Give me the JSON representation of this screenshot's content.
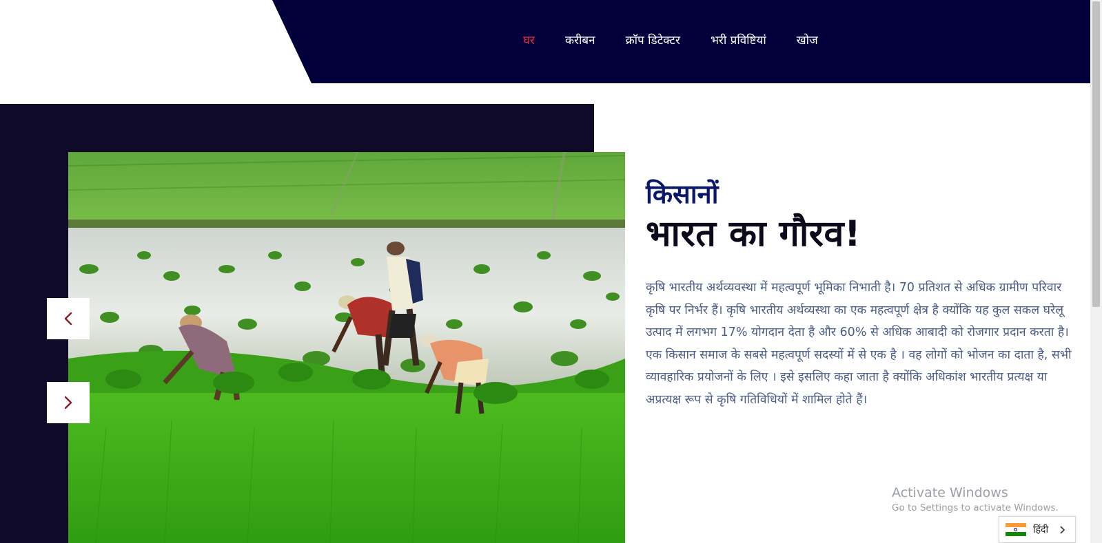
{
  "nav": {
    "items": [
      {
        "label": "घर",
        "active": true
      },
      {
        "label": "करीबन",
        "active": false
      },
      {
        "label": "क्रॉप डिटेक्टर",
        "active": false
      },
      {
        "label": "भरी प्रविष्टियां",
        "active": false
      },
      {
        "label": "खोज",
        "active": false
      }
    ],
    "background_color": "#02003a",
    "active_color": "#e6293b"
  },
  "hero": {
    "subtitle": "किसानों",
    "title": "भारत का गौरव!",
    "body": "कृषि भारतीय अर्थव्यवस्था में महत्वपूर्ण भूमिका निभाती है। 70 प्रतिशत से अधिक ग्रामीण परिवार कृषि पर निर्भर हैं। कृषि भारतीय अर्थव्यस्था का एक महत्वपूर्ण क्षेत्र है क्योंकि यह कुल सकल घरेलू उत्पाद में लगभग 17% योगदान देता है और 60% से अधिक आबादी को रोजगार प्रदान करता है। एक किसान समाज के सबसे महत्वपूर्ण सदस्यों में से एक है । वह लोगों को भोजन का दाता है, सभी व्यावहारिक प्रयोजनों के लिए । इसे इसलिए कहा जाता है क्योंकि अधिकांश भारतीय प्रत्यक्ष या अप्रत्यक्ष रूप से कृषि गतिविधियों में शामिल होते हैं।",
    "prev_icon": "chevron-left-icon",
    "next_icon": "chevron-right-icon",
    "image_icon": "rice-field-farmers-photo"
  },
  "watermark": {
    "line1": "Activate Windows",
    "line2": "Go to Settings to activate Windows."
  },
  "language": {
    "label": "हिंदी",
    "flag_icon": "india-flag-icon",
    "chevron_icon": "chevron-right-icon"
  }
}
